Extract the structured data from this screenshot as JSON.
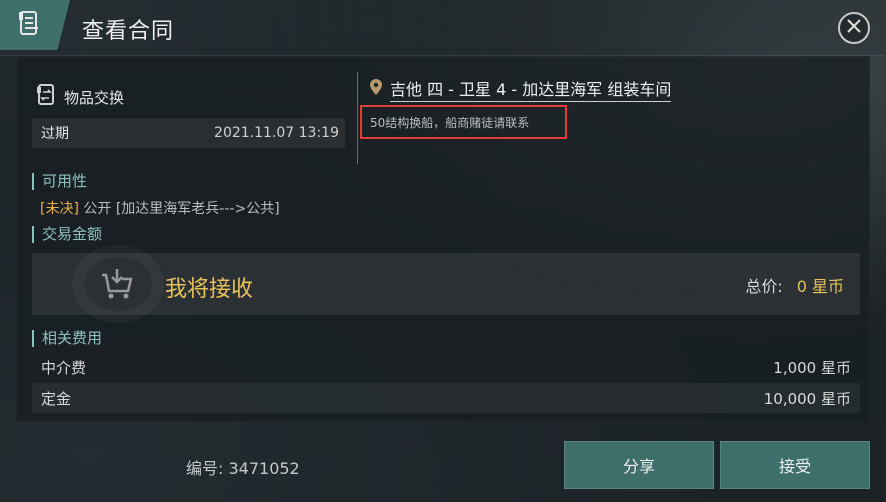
{
  "header": {
    "title": "查看合同",
    "badge_icon": "contract-scroll-icon",
    "close_icon": "close-icon"
  },
  "contract": {
    "type_icon": "item-exchange-icon",
    "type_label": "物品交换",
    "expire_label": "过期",
    "expire_value": "2021.11.07 13:19",
    "location": "吉他 四 - 卫星 4 - 加达里海军 组装车间",
    "location_icon": "map-pin-icon",
    "note": "50结构换船，船商赌徒请联系"
  },
  "availability": {
    "section_label": "可用性",
    "status": "[未决]",
    "detail": "公开 [加达里海军老兵--->公共]"
  },
  "trade_amount": {
    "section_label": "交易金额",
    "receive_icon": "cart-download-icon",
    "receive_label": "我将接收",
    "total_label": "总价:",
    "total_value": "0 星币"
  },
  "fees": {
    "section_label": "相关费用",
    "rows": [
      {
        "label": "中介费",
        "value": "1,000 星币"
      },
      {
        "label": "定金",
        "value": "10,000 星币"
      }
    ]
  },
  "footer": {
    "contract_id": "编号: 3471052",
    "share_label": "分享",
    "accept_label": "接受"
  },
  "colors": {
    "accent": "#3e6f6a",
    "section": "#8fc2bc",
    "gold": "#e8c25a",
    "highlight_border": "#e03a3a"
  }
}
